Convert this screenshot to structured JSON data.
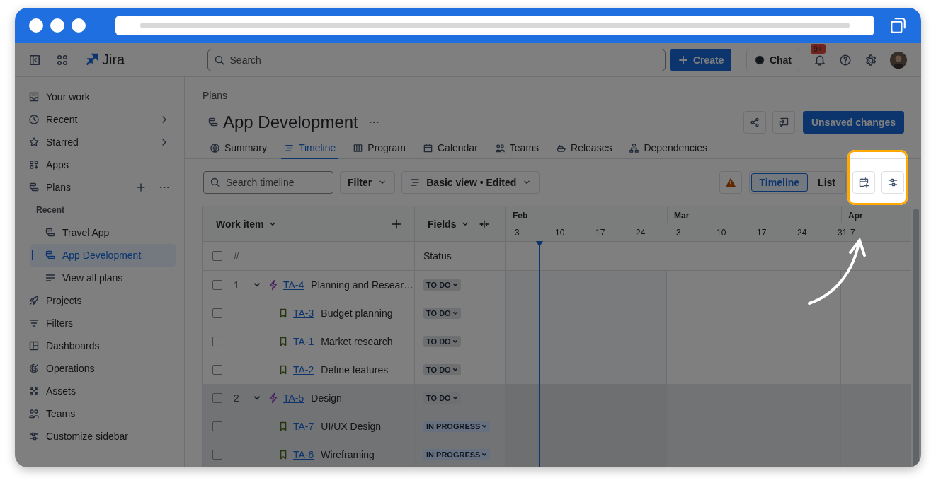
{
  "topbar": {
    "product": "Jira",
    "search": {
      "placeholder": "Search"
    },
    "create_button": "Create",
    "chat_button": "Chat",
    "notification_badge": "9+"
  },
  "sidebar": {
    "items": [
      {
        "label": "Your work",
        "kind": "link",
        "selected": false
      },
      {
        "label": "Recent",
        "kind": "submenu",
        "selected": false
      },
      {
        "label": "Starred",
        "kind": "submenu",
        "selected": false
      },
      {
        "label": "Apps",
        "kind": "link",
        "selected": false
      },
      {
        "label": "Plans",
        "kind": "section",
        "selected": false,
        "children": [
          {
            "label": "Recent",
            "kind": "heading"
          },
          {
            "label": "Travel App",
            "kind": "plan",
            "selected": false
          },
          {
            "label": "App Development",
            "kind": "plan",
            "selected": true
          },
          {
            "label": "View all plans",
            "kind": "all",
            "selected": false
          }
        ]
      },
      {
        "label": "Projects",
        "kind": "link",
        "selected": false
      },
      {
        "label": "Filters",
        "kind": "link",
        "selected": false
      },
      {
        "label": "Dashboards",
        "kind": "link",
        "selected": false
      },
      {
        "label": "Operations",
        "kind": "link",
        "selected": false
      },
      {
        "label": "Assets",
        "kind": "link",
        "selected": false
      },
      {
        "label": "Teams",
        "kind": "link",
        "selected": false
      },
      {
        "label": "Customize sidebar",
        "kind": "link",
        "selected": false
      }
    ]
  },
  "page": {
    "breadcrumb": "Plans",
    "title": "App Development",
    "unsaved_button": "Unsaved changes",
    "tabs": [
      {
        "label": "Summary",
        "selected": false
      },
      {
        "label": "Timeline",
        "selected": true
      },
      {
        "label": "Program",
        "selected": false
      },
      {
        "label": "Calendar",
        "selected": false
      },
      {
        "label": "Teams",
        "selected": false
      },
      {
        "label": "Releases",
        "selected": false
      },
      {
        "label": "Dependencies",
        "selected": false
      }
    ]
  },
  "toolbar": {
    "search": {
      "placeholder": "Search timeline"
    },
    "filter_button": "Filter",
    "view_button": "Basic view • Edited",
    "view_toggle": [
      {
        "label": "Timeline",
        "selected": true
      },
      {
        "label": "List",
        "selected": false
      }
    ]
  },
  "table": {
    "columns": {
      "work_item": "Work item",
      "fields": "Fields",
      "number": "#",
      "status": "Status"
    },
    "select_all": {
      "checked": false
    },
    "months": [
      {
        "label": "Feb",
        "weeks": [
          "3",
          "10",
          "17",
          "24"
        ]
      },
      {
        "label": "Mar",
        "weeks": [
          "3",
          "10",
          "17",
          "24",
          "31"
        ]
      },
      {
        "label": "Apr",
        "weeks": [
          "7"
        ]
      }
    ],
    "rows": [
      {
        "number": "1",
        "kind": "epic",
        "key": "TA-4",
        "summary": "Planning and Resear…",
        "status": {
          "label": "TO DO",
          "kind": "todo"
        },
        "checked": false,
        "expanded": true,
        "highlighted": false,
        "children": [
          {
            "kind": "story",
            "key": "TA-3",
            "summary": "Budget planning",
            "status": {
              "label": "TO DO",
              "kind": "todo"
            },
            "checked": false,
            "highlighted": false
          },
          {
            "kind": "story",
            "key": "TA-1",
            "summary": "Market research",
            "status": {
              "label": "TO DO",
              "kind": "todo"
            },
            "checked": false,
            "highlighted": false
          },
          {
            "kind": "story",
            "key": "TA-2",
            "summary": "Define features",
            "status": {
              "label": "TO DO",
              "kind": "todo"
            },
            "checked": false,
            "highlighted": false
          }
        ]
      },
      {
        "number": "2",
        "kind": "epic",
        "key": "TA-5",
        "summary": "Design",
        "status": {
          "label": "TO DO",
          "kind": "todo"
        },
        "checked": false,
        "expanded": true,
        "highlighted": true,
        "children": [
          {
            "kind": "story",
            "key": "TA-7",
            "summary": "UI/UX Design",
            "status": {
              "label": "IN PROGRESS",
              "kind": "in_progress"
            },
            "checked": false,
            "highlighted": true
          },
          {
            "kind": "story",
            "key": "TA-6",
            "summary": "Wireframing",
            "status": {
              "label": "IN PROGRESS",
              "kind": "in_progress"
            },
            "checked": false,
            "highlighted": true
          }
        ]
      }
    ]
  }
}
